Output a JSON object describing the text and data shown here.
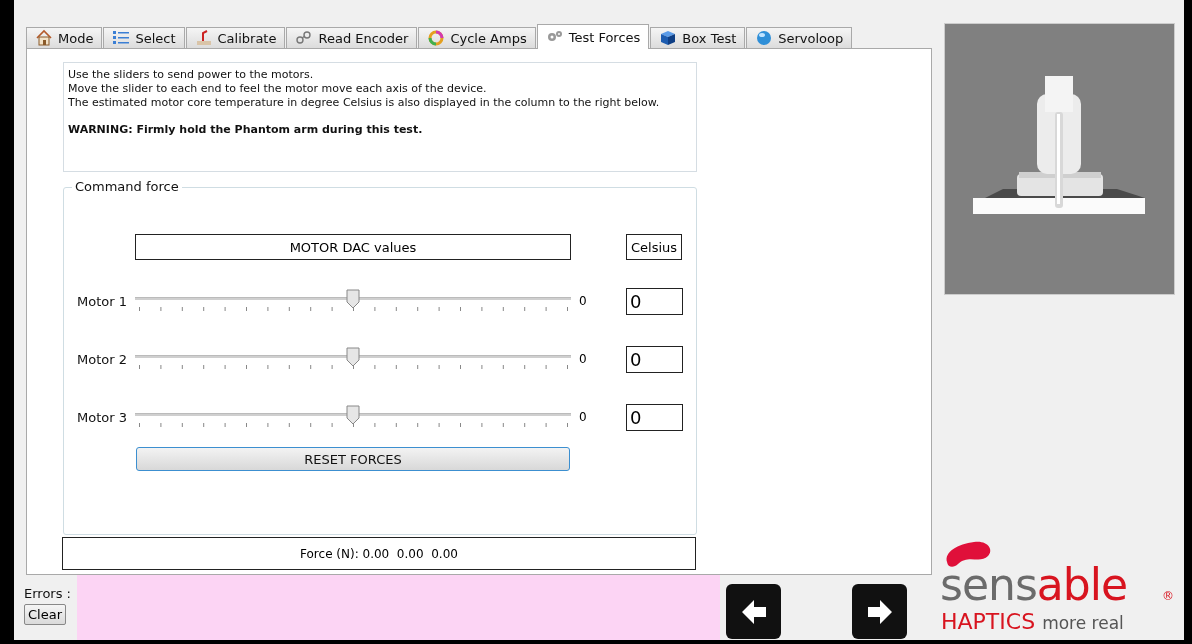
{
  "tabs": [
    {
      "label": "Mode",
      "selected": false
    },
    {
      "label": "Select",
      "selected": false
    },
    {
      "label": "Calibrate",
      "selected": false
    },
    {
      "label": "Read Encoder",
      "selected": false
    },
    {
      "label": "Cycle Amps",
      "selected": false
    },
    {
      "label": "Test Forces",
      "selected": true
    },
    {
      "label": "Box Test",
      "selected": false
    },
    {
      "label": "Servoloop",
      "selected": false
    }
  ],
  "instructions": {
    "lines": [
      "Use the sliders to send power to the motors.",
      "Move the slider to each end to feel the motor move each axis of the device.",
      "The estimated motor core temperature in degree Celsius is also displayed in the column to the right below."
    ],
    "warning": "WARNING: Firmly hold the Phantom arm during this test."
  },
  "command_force": {
    "title": "Command force",
    "dac_header": "MOTOR DAC values",
    "celsius_header": "Celsius",
    "motors": [
      {
        "name": "Motor 1",
        "level": 0.5,
        "reading": "0",
        "celsius": "0"
      },
      {
        "name": "Motor 2",
        "level": 0.5,
        "reading": "0",
        "celsius": "0"
      },
      {
        "name": "Motor 3",
        "level": 0.5,
        "reading": "0",
        "celsius": "0"
      }
    ],
    "reset_button": "RESET FORCES"
  },
  "force_readout": "Force (N): 0.00  0.00  0.00",
  "errors": {
    "label": "Errors :",
    "clear_button": "Clear"
  },
  "logo": {
    "word_first": "sens",
    "word_second": "able",
    "mark": "®",
    "tagline_first": "HAPTICS",
    "tagline_second": "more real"
  }
}
